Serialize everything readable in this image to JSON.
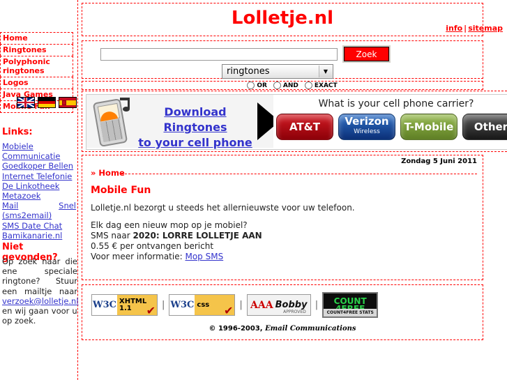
{
  "site": {
    "title": "Lolletje.nl",
    "header_links": [
      {
        "label": "info"
      },
      {
        "label": "sitemap"
      }
    ],
    "header_separator": "|"
  },
  "sidebar": {
    "nav_items": [
      {
        "label": "Home"
      },
      {
        "label": "Ringtones"
      },
      {
        "label": "Polyphonic ringtones"
      },
      {
        "label": "Logos"
      },
      {
        "label": "Java Games"
      },
      {
        "label": "Mobile Fun"
      }
    ],
    "flags": [
      {
        "name": "flag-uk",
        "title": "English"
      },
      {
        "name": "flag-de",
        "title": "Deutsch"
      },
      {
        "name": "flag-es",
        "title": "Espanol"
      }
    ],
    "links_heading": "Links:",
    "links": [
      {
        "label": "Mobiele Communicatie"
      },
      {
        "label": "Goedkoper Bellen"
      },
      {
        "label": "Internet Telefonie"
      },
      {
        "label": "De Linkotheek"
      },
      {
        "label": "Metazoek"
      },
      {
        "label": "Mail",
        "label_right": "Snel"
      },
      {
        "label": "(sms2email)"
      },
      {
        "label": "SMS Date Chat"
      },
      {
        "label": "Bamikanarie.nl"
      }
    ],
    "not_found_heading": "Niet gevonden?",
    "not_found_text_before": "Op zoek naar die ene speciale ringtone? Stuur een mailtje naar ",
    "not_found_email": "verzoek@lolletje.nl",
    "not_found_text_after": " en wij gaan voor u op zoek."
  },
  "search": {
    "input_value": "",
    "input_placeholder": "",
    "button_label": "Zoek",
    "selected_category": "ringtones",
    "category_options": [
      "ringtones"
    ],
    "dropdown_arrow": "▼",
    "modes": [
      {
        "label": "OR",
        "selected": false
      },
      {
        "label": "AND",
        "selected": false
      },
      {
        "label": "EXACT",
        "selected": false
      }
    ]
  },
  "banner": {
    "headline_line1": "Download Ringtones",
    "headline_line2": "to your cell phone",
    "question": "What is your cell phone carrier?",
    "carriers": [
      {
        "label": "AT&T",
        "sub": "",
        "color": "#b0131c"
      },
      {
        "label": "Verizon",
        "sub": "Wireless",
        "color": "#1d4fa0"
      },
      {
        "label": "T-Mobile",
        "sub": "",
        "color": "#7a9e39"
      },
      {
        "label": "Other",
        "sub": "",
        "color": "#333333"
      }
    ]
  },
  "content": {
    "date": "Zondag 5 Juni 2011",
    "breadcrumb": "» Home",
    "title": "Mobile Fun",
    "intro": "Lolletje.nl bezorgt u steeds het allernieuwste voor uw telefoon.",
    "promo_line1": "Elk dag een nieuw mop op je mobiel?",
    "promo_sms_prefix": "SMS naar ",
    "promo_sms_number": "2020",
    "promo_sms_keyword": ": LORRE LOLLETJE AAN",
    "promo_price": "0.55 € per ontvangen bericht",
    "promo_more_prefix": "Voor meer informatie: ",
    "promo_more_link": "Mop SMS"
  },
  "footer": {
    "badges": [
      {
        "name": "w3c-xhtml-badge",
        "left": "W3C",
        "right_line1": "XHTML",
        "right_line2": "1.1",
        "check": "✔"
      },
      {
        "name": "w3c-css-badge",
        "left": "W3C",
        "right_line1": "css",
        "right_line2": "",
        "check": "✔"
      },
      {
        "name": "bobby-approved-badge",
        "aaa": "AAA",
        "title": "Bobby",
        "sub": "APPROVED"
      },
      {
        "name": "count4free-badge",
        "line1": "COUNT",
        "line2": "4FREE",
        "stats": "COUNT4FREE STATS"
      }
    ],
    "badge_separator": "|",
    "copyright_prefix": "© 1996-2003, ",
    "copyright_company": "Email Communications"
  }
}
